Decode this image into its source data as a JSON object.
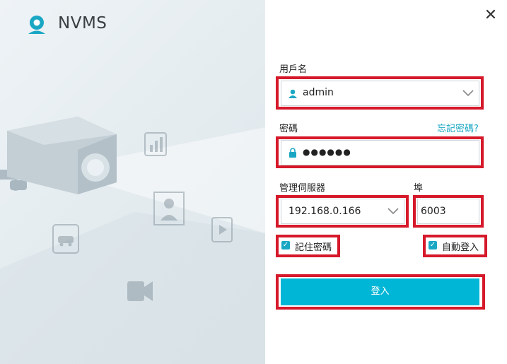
{
  "app": {
    "title": "NVMS"
  },
  "window": {
    "close_symbol": "✕"
  },
  "form": {
    "username_label": "用戶名",
    "username_value": "admin",
    "password_label": "密碼",
    "forgot_password": "忘記密碼?",
    "password_value": "●●●●●●",
    "server_label": "管理伺服器",
    "server_value": "192.168.0.166",
    "port_label": "埠",
    "port_value": "6003",
    "remember_password_label": "記住密碼",
    "remember_password_checked": true,
    "auto_login_label": "自動登入",
    "auto_login_checked": true,
    "login_button": "登入"
  },
  "icons": {
    "logo": "webcam-logo-icon",
    "user": "user-icon",
    "lock": "lock-icon",
    "dropdown": "chevron-down-icon",
    "close": "close-icon",
    "checkbox": "checkmark-icon"
  },
  "colors": {
    "accent": "#00b6d6",
    "link": "#1aa7c4",
    "annotation": "#d6192a"
  }
}
